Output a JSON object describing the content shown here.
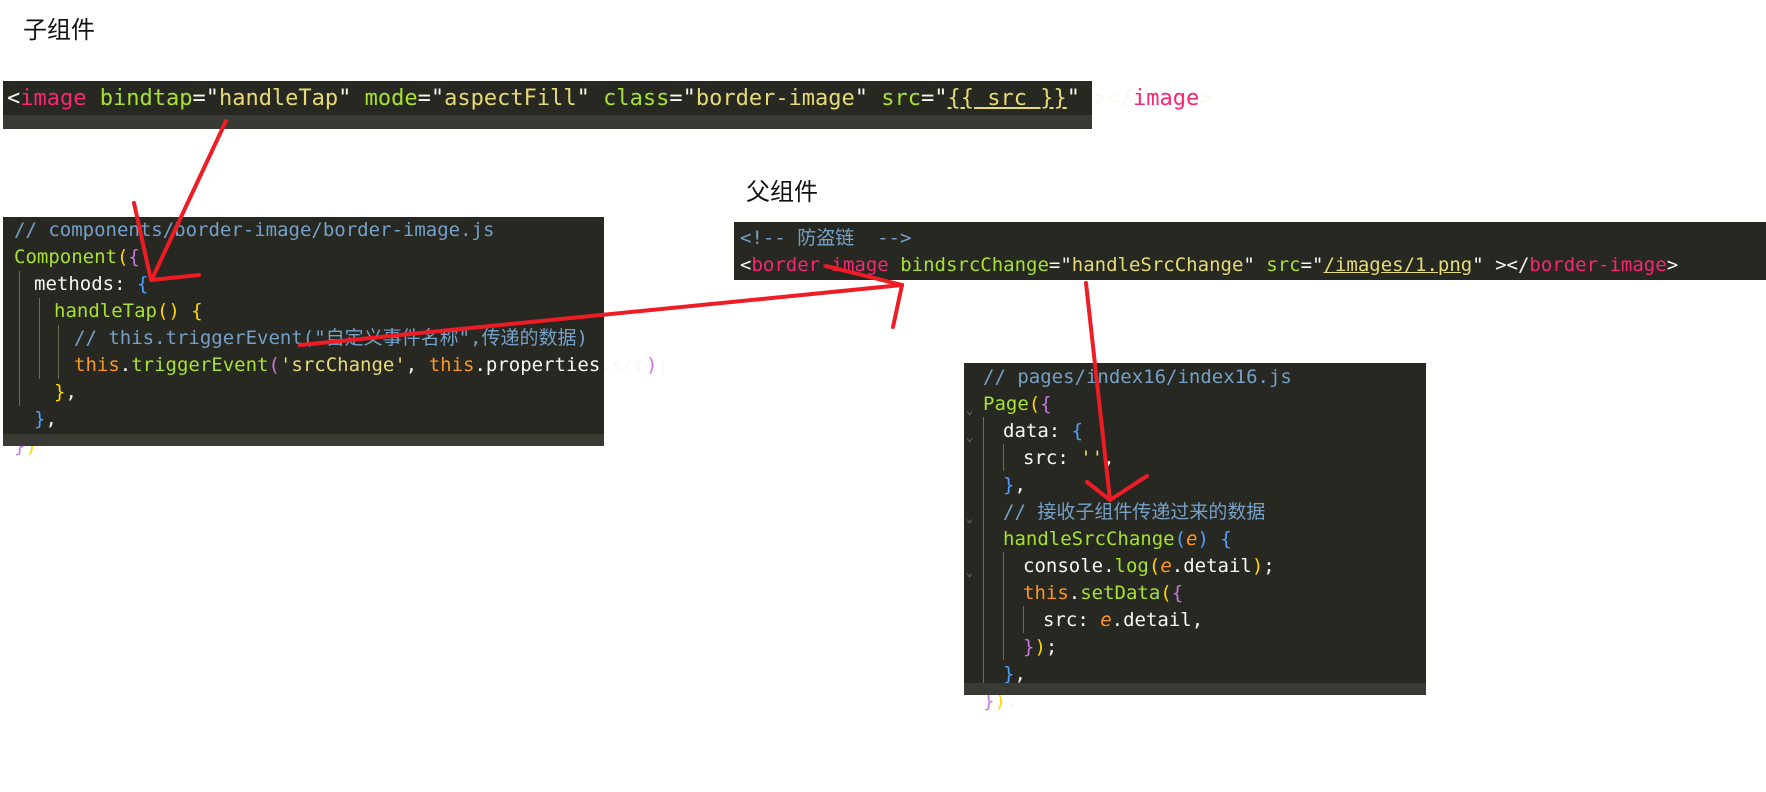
{
  "labels": {
    "child": "子组件",
    "parent": "父组件"
  },
  "child_wxml": {
    "open_bracket": "<",
    "tag": "image",
    "attr1": "bindtap",
    "eq1": "=\"",
    "val1": "handleTap",
    "q1": "\" ",
    "attr2": "mode",
    "eq2": "=\"",
    "val2": "aspectFill",
    "q2": "\" ",
    "attr3": "class",
    "eq3": "=\"",
    "val3": "border-image",
    "q3": "\" ",
    "attr4": "src",
    "eq4": "=\"",
    "val4": "{{ src }}",
    "q4": "\" ",
    "close_open": "></",
    "close_tag": "image",
    "close_end": ">"
  },
  "child_js": {
    "comment": "// components/border-image/border-image.js",
    "component": "Component",
    "methods": "methods",
    "handle_tap": "handleTap",
    "comment2": "// this.triggerEvent(\"自定义事件名称\",传递的数据)",
    "this1": "this",
    "trigger": "triggerEvent",
    "event_name": "'srcChange'",
    "this2": "this",
    "props": ".properties.src"
  },
  "parent_wxml": {
    "comment": "<!-- 防盗链  -->",
    "tag": "border-image",
    "attr1": "bindsrcChange",
    "val1": "handleSrcChange",
    "attr2": "src",
    "val2": "/images/1.png",
    "close_tag": "border-image"
  },
  "parent_js": {
    "comment": "// pages/index16/index16.js",
    "page": "Page",
    "data_key": "data",
    "src_key": "src",
    "src_val": "''",
    "comment2": "// 接收子组件传递过来的数据",
    "handler": "handleSrcChange",
    "param": "e",
    "console": "console",
    "log": "log",
    "detail": ".detail",
    "this": "this",
    "set_data": "setData",
    "src_key2": "src"
  },
  "colors": {
    "editor_bg": "#272822",
    "arrow": "#ee1c25"
  }
}
